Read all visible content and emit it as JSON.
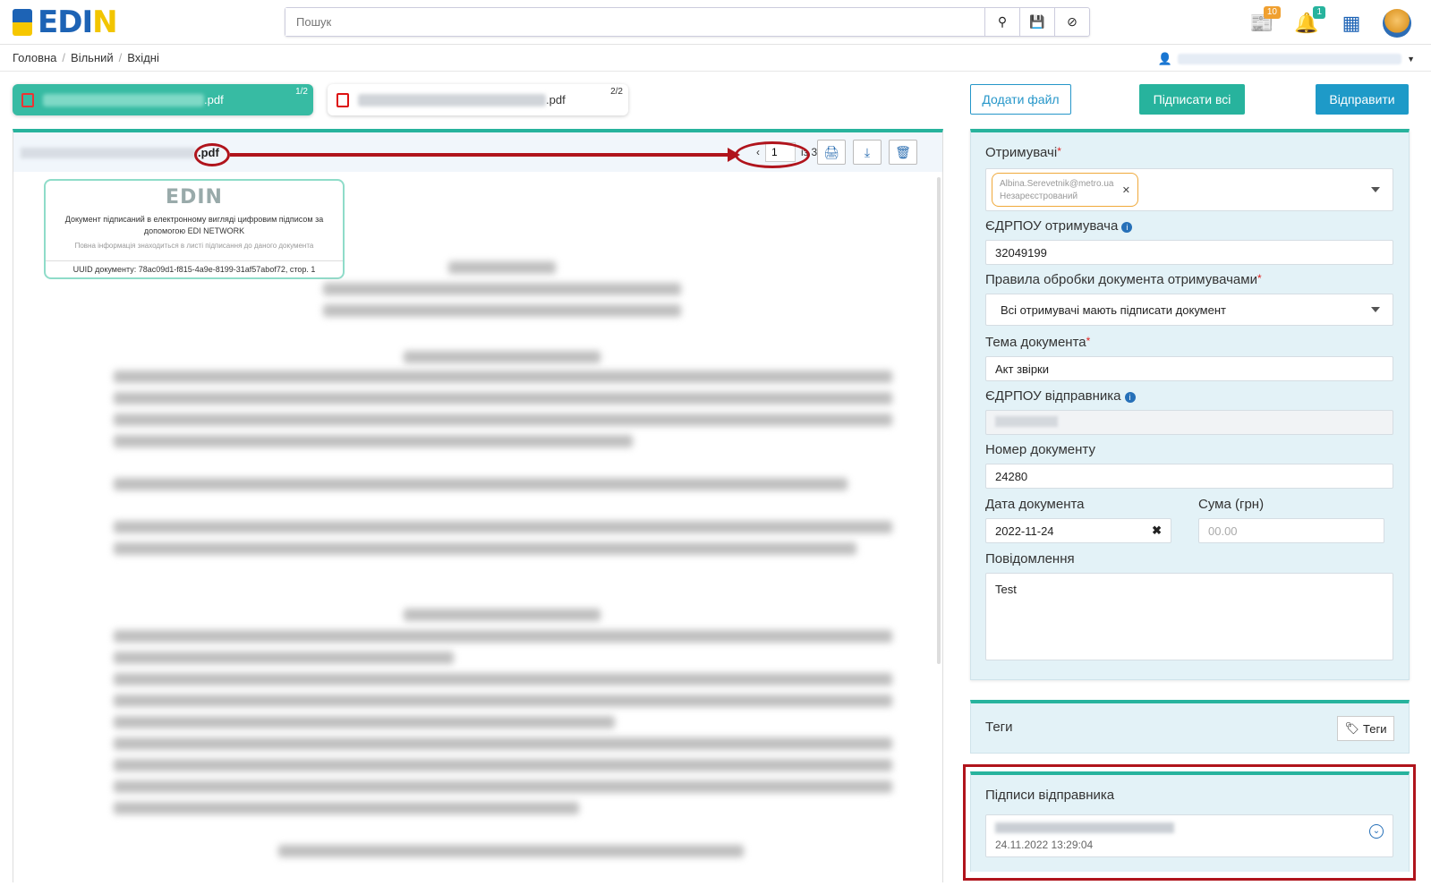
{
  "header": {
    "logo_text_blue": "ED",
    "logo_text_yellow": "N",
    "logo_text_mid": "I",
    "search_placeholder": "Пошук",
    "news_badge": "10",
    "notif_badge": "1"
  },
  "breadcrumb": [
    "Головна",
    "Вільний",
    "Вхідні"
  ],
  "files": [
    {
      "ext": ".pdf",
      "count": "1/2"
    },
    {
      "ext": ".pdf",
      "count": "2/2"
    }
  ],
  "actions": {
    "add_file": "Додати файл",
    "sign_all": "Підписати всі",
    "send": "Відправити"
  },
  "viewer": {
    "file_ext": ".pdf",
    "page_input": "1",
    "page_of": "із 3",
    "stamp": {
      "logo": "EDIN",
      "line1": "Документ підписаний в електронному вигляді цифровим підписом за допомогою EDI NETWORK",
      "line2": "Повна інформація знаходиться в листі підписання до даного документа",
      "uuid": "UUID документу: 78ac09d1-f815-4a9e-8199-31af57abof72, стор. 1"
    }
  },
  "form": {
    "recipients_label": "Отримувачі",
    "recipient_email": "Albina.Serevetnik@metro.ua",
    "recipient_status": "Незареєстрований",
    "edrpou_recipient_label": "ЄДРПОУ отримувача",
    "edrpou_recipient": "32049199",
    "rules_label": "Правила обробки документа отримувачами",
    "rules_value": "Всі отримувачі мають підписати документ",
    "subject_label": "Тема документа",
    "subject_value": "Акт звірки",
    "edrpou_sender_label": "ЄДРПОУ відправника",
    "doc_number_label": "Номер документу",
    "doc_number": "24280",
    "doc_date_label": "Дата документа",
    "doc_date": "2022-11-24",
    "sum_label": "Сума (грн)",
    "sum_placeholder": "00.00",
    "message_label": "Повідомлення",
    "message": "Test"
  },
  "tags": {
    "title": "Теги",
    "button": "Теги"
  },
  "signatures": {
    "title": "Підписи відправника",
    "datetime": "24.11.2022 13:29:04"
  },
  "colors": {
    "accent": "#27b39d",
    "primary": "#1e9ac8",
    "highlight": "#b0141c"
  }
}
